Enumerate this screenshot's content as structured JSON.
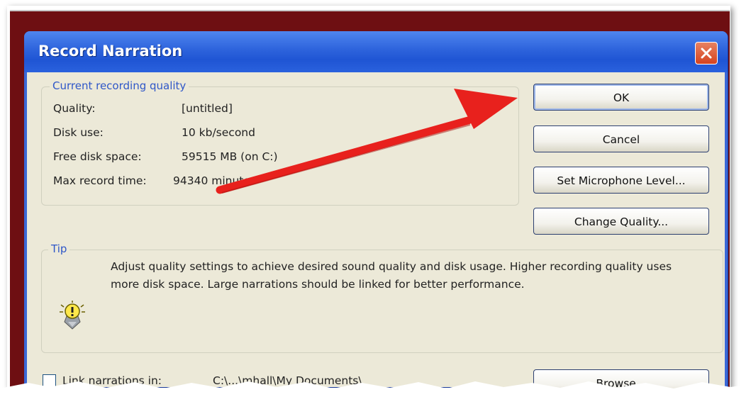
{
  "dialog": {
    "title": "Record Narration",
    "close_icon": "close-icon"
  },
  "quality_group": {
    "legend": "Current recording quality",
    "rows": [
      {
        "label": "Quality:",
        "value": "[untitled]"
      },
      {
        "label": "Disk use:",
        "value": "10 kb/second"
      },
      {
        "label": "Free disk space:",
        "value": "59515 MB (on C:)"
      },
      {
        "label": "Max record time:",
        "value": "94340 minutes"
      }
    ]
  },
  "buttons": {
    "ok": "OK",
    "cancel": "Cancel",
    "set_mic": "Set Microphone Level...",
    "change_quality": "Change Quality...",
    "browse": "Browse..."
  },
  "tip_group": {
    "legend": "Tip",
    "icon": "lightbulb-icon",
    "text": "Adjust quality settings to achieve desired sound quality and disk usage. Higher recording quality uses more disk space. Large narrations should be linked for better performance."
  },
  "link": {
    "label": "Link narrations in:",
    "checked": false,
    "path": "C:\\...\\mhall\\My Documents\\"
  },
  "colors": {
    "titlebar": "#2d63dc",
    "dialog_bg": "#ece9d8",
    "group_label": "#2f57c8",
    "background_window": "#6e0f12",
    "annotation_arrow": "#e8211d"
  }
}
